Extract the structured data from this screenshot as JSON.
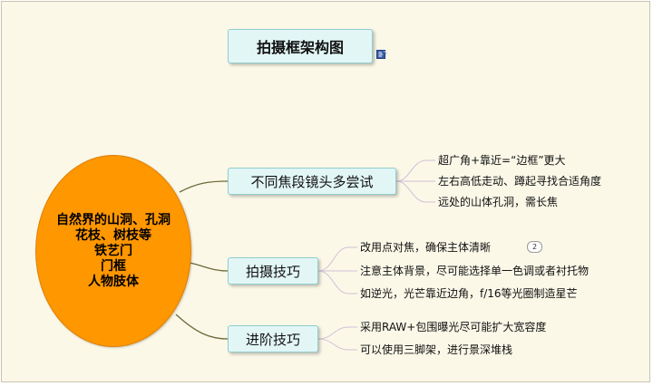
{
  "title": "拍摄框架构图",
  "root": {
    "lines": [
      "自然界的山洞、孔洞",
      "花枝、树枝等",
      "铁艺门",
      "门框",
      "人物肢体"
    ]
  },
  "branches": [
    {
      "label": "不同焦段镜头多尝试",
      "leaves": [
        "超广角+靠近=“边框”更大",
        "左右高低走动、蹲起寻找合适角度",
        "远处的山体孔洞，需长焦"
      ]
    },
    {
      "label": "拍摄技巧",
      "leaves": [
        "改用点对焦，确保主体清晰",
        "注意主体背景，尽可能选择单一色调或者衬托物",
        "如逆光，光芒靠近边角，f/16等光圈制造星芒"
      ],
      "badge": "2"
    },
    {
      "label": "进阶技巧",
      "leaves": [
        "采用RAW+包围曝光尽可能扩大宽容度",
        "可以使用三脚架，进行景深堆栈"
      ]
    }
  ],
  "colors": {
    "background": "#fbf8e8",
    "topic_fill": "#e2f6f6",
    "topic_border": "#8fcfcf",
    "root_fill": "#ff9700",
    "connector": "#6b6b3a",
    "leaf_connector": "#cfc1d8"
  },
  "icons": {
    "note": "note-icon"
  }
}
